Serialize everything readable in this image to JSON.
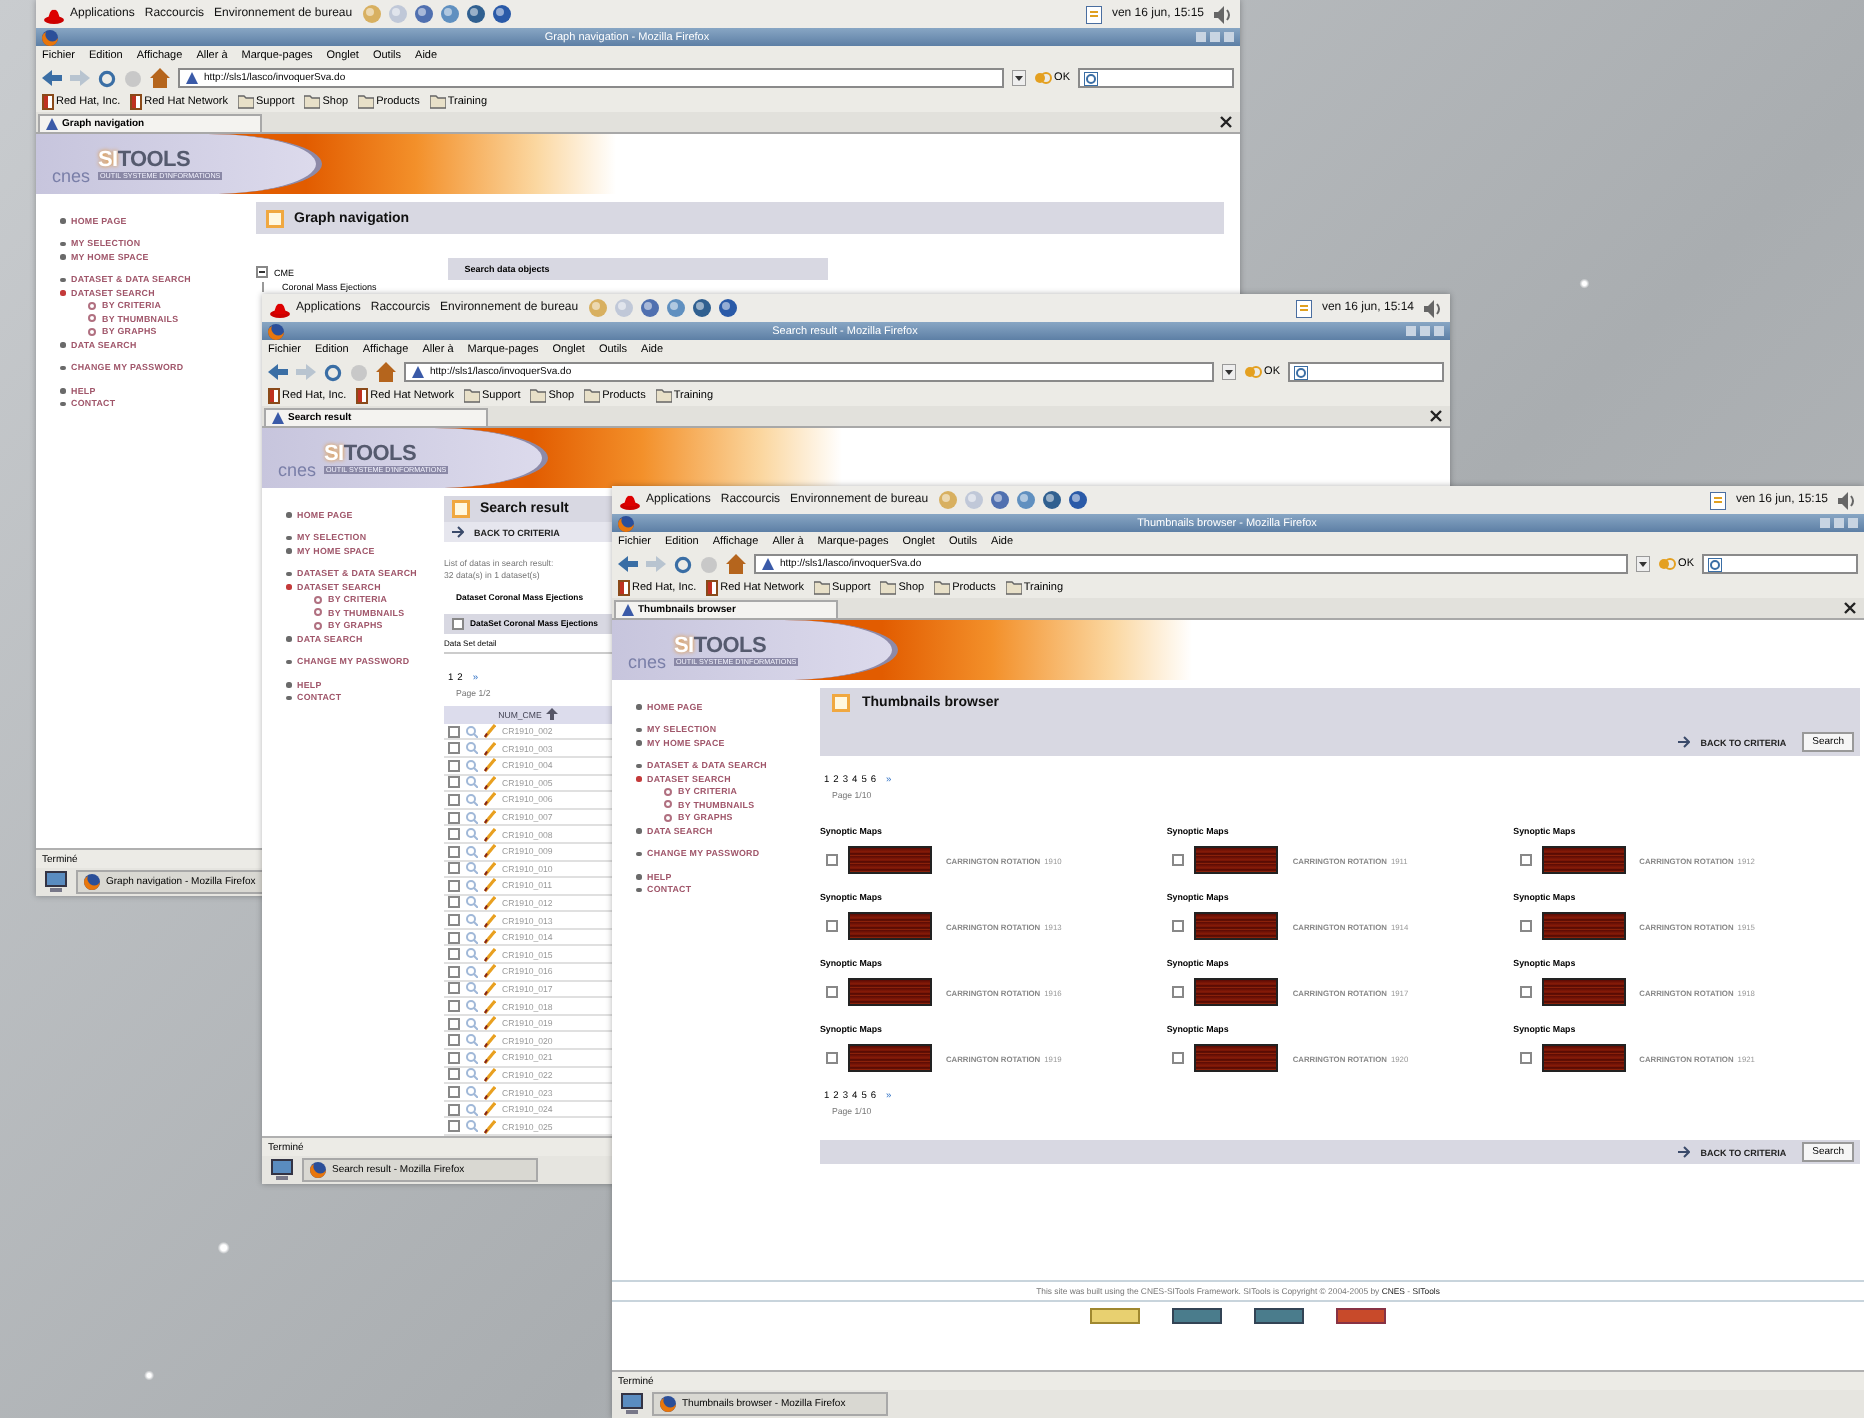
{
  "windows": [
    {
      "panel": {
        "menus": [
          "Applications",
          "Raccourcis",
          "Environnement de bureau"
        ],
        "clock": "ven 16 jun, 15:15"
      },
      "title": "Graph navigation - Mozilla Firefox",
      "menu_bar": [
        "Fichier",
        "Edition",
        "Affichage",
        "Aller à",
        "Marque-pages",
        "Onglet",
        "Outils",
        "Aide"
      ],
      "address": "http://sls1/lasco/invoquerSva.do",
      "go_button": "OK",
      "bookmarks": [
        {
          "label": "Red Hat, Inc.",
          "kind": "page"
        },
        {
          "label": "Red Hat Network",
          "kind": "page"
        },
        {
          "label": "Support",
          "kind": "folder"
        },
        {
          "label": "Shop",
          "kind": "folder"
        },
        {
          "label": "Products",
          "kind": "folder"
        },
        {
          "label": "Training",
          "kind": "folder"
        }
      ],
      "tab": "Graph navigation",
      "banner": {
        "logo": "cnes",
        "brand": "**SI**TOOLS",
        "tagline": "OUTIL SYSTEME D'INFORMATIONS"
      },
      "sidebar": [
        {
          "items": [
            {
              "label": "HOME PAGE",
              "expanded": false
            }
          ]
        },
        {
          "items": [
            {
              "label": "MY SELECTION",
              "expanded": false
            },
            {
              "label": "MY HOME SPACE",
              "expanded": false
            }
          ]
        },
        {
          "items": [
            {
              "label": "DATASET & DATA SEARCH",
              "expanded": false
            },
            {
              "label": "DATASET SEARCH",
              "expanded": true,
              "children": [
                "BY CRITERIA",
                "BY THUMBNAILS",
                "BY GRAPHS"
              ]
            },
            {
              "label": "DATA SEARCH",
              "expanded": false
            }
          ]
        },
        {
          "items": [
            {
              "label": "CHANGE MY PASSWORD",
              "expanded": false
            }
          ]
        },
        {
          "items": [
            {
              "label": "HELP",
              "expanded": false
            },
            {
              "label": "CONTACT",
              "expanded": false
            }
          ]
        }
      ],
      "page": {
        "kind": "graph",
        "heading": "Graph navigation",
        "tree": [
          {
            "label": "CME",
            "expanded": true,
            "children": [
              {
                "label": "Coronal Mass Ejections"
              }
            ]
          }
        ],
        "panel_title": "Search data objects"
      },
      "status": "Terminé",
      "taskbar_button": "Graph navigation - Mozilla Firefox"
    },
    {
      "panel": {
        "menus": [
          "Applications",
          "Raccourcis",
          "Environnement de bureau"
        ],
        "clock": "ven 16 jun, 15:14"
      },
      "title": "Search result - Mozilla Firefox",
      "menu_bar": [
        "Fichier",
        "Edition",
        "Affichage",
        "Aller à",
        "Marque-pages",
        "Onglet",
        "Outils",
        "Aide"
      ],
      "address": "http://sls1/lasco/invoquerSva.do",
      "go_button": "OK",
      "bookmarks": [
        {
          "label": "Red Hat, Inc.",
          "kind": "page"
        },
        {
          "label": "Red Hat Network",
          "kind": "page"
        },
        {
          "label": "Support",
          "kind": "folder"
        },
        {
          "label": "Shop",
          "kind": "folder"
        },
        {
          "label": "Products",
          "kind": "folder"
        },
        {
          "label": "Training",
          "kind": "folder"
        }
      ],
      "tab": "Search result",
      "banner": {
        "logo": "cnes",
        "brand": "**SI**TOOLS",
        "tagline": "OUTIL SYSTEME D'INFORMATIONS"
      },
      "sidebar": [
        {
          "items": [
            {
              "label": "HOME PAGE",
              "expanded": false
            }
          ]
        },
        {
          "items": [
            {
              "label": "MY SELECTION",
              "expanded": false
            },
            {
              "label": "MY HOME SPACE",
              "expanded": false
            }
          ]
        },
        {
          "items": [
            {
              "label": "DATASET & DATA SEARCH",
              "expanded": false
            },
            {
              "label": "DATASET SEARCH",
              "expanded": true,
              "children": [
                "BY CRITERIA",
                "BY THUMBNAILS",
                "BY GRAPHS"
              ]
            },
            {
              "label": "DATA SEARCH",
              "expanded": false
            }
          ]
        },
        {
          "items": [
            {
              "label": "CHANGE MY PASSWORD",
              "expanded": false
            }
          ]
        },
        {
          "items": [
            {
              "label": "HELP",
              "expanded": false
            },
            {
              "label": "CONTACT",
              "expanded": false
            }
          ]
        }
      ],
      "page": {
        "kind": "result",
        "heading": "Search result",
        "back": "BACK TO CRITERIA",
        "info": [
          "List of datas in search result:",
          "32 data(s) in 1 dataset(s)"
        ],
        "dataset": "Dataset Coronal Mass Ejections",
        "dataset_box": {
          "label": "DataSet Coronal Mass Ejections",
          "checked": false
        },
        "detail": "Data Set detail",
        "pager": {
          "pages": [
            "1",
            "2"
          ],
          "next": "»"
        },
        "page_label": "Page 1/2",
        "column": "NUM_CME",
        "rows": [
          {
            "id": "CR1910_002",
            "checked": false
          },
          {
            "id": "CR1910_003",
            "checked": false
          },
          {
            "id": "CR1910_004",
            "checked": false
          },
          {
            "id": "CR1910_005",
            "checked": false
          },
          {
            "id": "CR1910_006",
            "checked": false
          },
          {
            "id": "CR1910_007",
            "checked": false
          },
          {
            "id": "CR1910_008",
            "checked": false
          },
          {
            "id": "CR1910_009",
            "checked": false
          },
          {
            "id": "CR1910_010",
            "checked": false
          },
          {
            "id": "CR1910_011",
            "checked": false
          },
          {
            "id": "CR1910_012",
            "checked": false
          },
          {
            "id": "CR1910_013",
            "checked": false
          },
          {
            "id": "CR1910_014",
            "checked": false
          },
          {
            "id": "CR1910_015",
            "checked": false
          },
          {
            "id": "CR1910_016",
            "checked": false
          },
          {
            "id": "CR1910_017",
            "checked": false
          },
          {
            "id": "CR1910_018",
            "checked": false
          },
          {
            "id": "CR1910_019",
            "checked": false
          },
          {
            "id": "CR1910_020",
            "checked": false
          },
          {
            "id": "CR1910_021",
            "checked": false
          },
          {
            "id": "CR1910_022",
            "checked": false
          },
          {
            "id": "CR1910_023",
            "checked": false
          },
          {
            "id": "CR1910_024",
            "checked": false
          },
          {
            "id": "CR1910_025",
            "checked": false
          }
        ]
      },
      "status": "Terminé",
      "taskbar_button": "Search result - Mozilla Firefox"
    },
    {
      "panel": {
        "menus": [
          "Applications",
          "Raccourcis",
          "Environnement de bureau"
        ],
        "clock": "ven 16 jun, 15:15"
      },
      "title": "Thumbnails browser - Mozilla Firefox",
      "menu_bar": [
        "Fichier",
        "Edition",
        "Affichage",
        "Aller à",
        "Marque-pages",
        "Onglet",
        "Outils",
        "Aide"
      ],
      "address": "http://sls1/lasco/invoquerSva.do",
      "go_button": "OK",
      "bookmarks": [
        {
          "label": "Red Hat, Inc.",
          "kind": "page"
        },
        {
          "label": "Red Hat Network",
          "kind": "page"
        },
        {
          "label": "Support",
          "kind": "folder"
        },
        {
          "label": "Shop",
          "kind": "folder"
        },
        {
          "label": "Products",
          "kind": "folder"
        },
        {
          "label": "Training",
          "kind": "folder"
        }
      ],
      "tab": "Thumbnails browser",
      "banner": {
        "logo": "cnes",
        "brand": "**SI**TOOLS",
        "tagline": "OUTIL SYSTEME D'INFORMATIONS"
      },
      "sidebar": [
        {
          "items": [
            {
              "label": "HOME PAGE",
              "expanded": false
            }
          ]
        },
        {
          "items": [
            {
              "label": "MY SELECTION",
              "expanded": false
            },
            {
              "label": "MY HOME SPACE",
              "expanded": false
            }
          ]
        },
        {
          "items": [
            {
              "label": "DATASET & DATA SEARCH",
              "expanded": false
            },
            {
              "label": "DATASET SEARCH",
              "expanded": true,
              "children": [
                "BY CRITERIA",
                "BY THUMBNAILS",
                "BY GRAPHS"
              ]
            },
            {
              "label": "DATA SEARCH",
              "expanded": false
            }
          ]
        },
        {
          "items": [
            {
              "label": "CHANGE MY PASSWORD",
              "expanded": false
            }
          ]
        },
        {
          "items": [
            {
              "label": "HELP",
              "expanded": false
            },
            {
              "label": "CONTACT",
              "expanded": false
            }
          ]
        }
      ],
      "page": {
        "kind": "thumbnails",
        "heading": "Thumbnails browser",
        "back": "BACK TO CRITERIA",
        "search_button": "Search",
        "pager": {
          "pages": [
            "1",
            "2",
            "3",
            "4",
            "5",
            "6"
          ],
          "next": "»"
        },
        "page_label": "Page 1/10",
        "items": [
          {
            "title": "Synoptic Maps",
            "caption": "CARRINGTON ROTATION",
            "number": "1910",
            "checked": false
          },
          {
            "title": "Synoptic Maps",
            "caption": "CARRINGTON ROTATION",
            "number": "1911",
            "checked": false
          },
          {
            "title": "Synoptic Maps",
            "caption": "CARRINGTON ROTATION",
            "number": "1912",
            "checked": false
          },
          {
            "title": "Synoptic Maps",
            "caption": "CARRINGTON ROTATION",
            "number": "1913",
            "checked": false
          },
          {
            "title": "Synoptic Maps",
            "caption": "CARRINGTON ROTATION",
            "number": "1914",
            "checked": false
          },
          {
            "title": "Synoptic Maps",
            "caption": "CARRINGTON ROTATION",
            "number": "1915",
            "checked": false
          },
          {
            "title": "Synoptic Maps",
            "caption": "CARRINGTON ROTATION",
            "number": "1916",
            "checked": false
          },
          {
            "title": "Synoptic Maps",
            "caption": "CARRINGTON ROTATION",
            "number": "1917",
            "checked": false
          },
          {
            "title": "Synoptic Maps",
            "caption": "CARRINGTON ROTATION",
            "number": "1918",
            "checked": false
          },
          {
            "title": "Synoptic Maps",
            "caption": "CARRINGTON ROTATION",
            "number": "1919",
            "checked": false
          },
          {
            "title": "Synoptic Maps",
            "caption": "CARRINGTON ROTATION",
            "number": "1920",
            "checked": false
          },
          {
            "title": "Synoptic Maps",
            "caption": "CARRINGTON ROTATION",
            "number": "1921",
            "checked": false
          }
        ],
        "pager_bottom": {
          "pages": [
            "1",
            "2",
            "3",
            "4",
            "5",
            "6"
          ],
          "next": "»"
        },
        "page_label_bottom": "Page 1/10",
        "back_bottom": "BACK TO CRITERIA",
        "search_button_bottom": "Search",
        "footer": [
          {
            "text": "This site was built using the CNES-SITools Framework. SITools is Copyright © 2004-2005 by "
          },
          {
            "link": "CNES"
          },
          {
            "text": " - "
          },
          {
            "link": "SITools"
          }
        ]
      },
      "status": "Terminé",
      "taskbar_button": "Thumbnails browser - Mozilla Firefox"
    }
  ]
}
